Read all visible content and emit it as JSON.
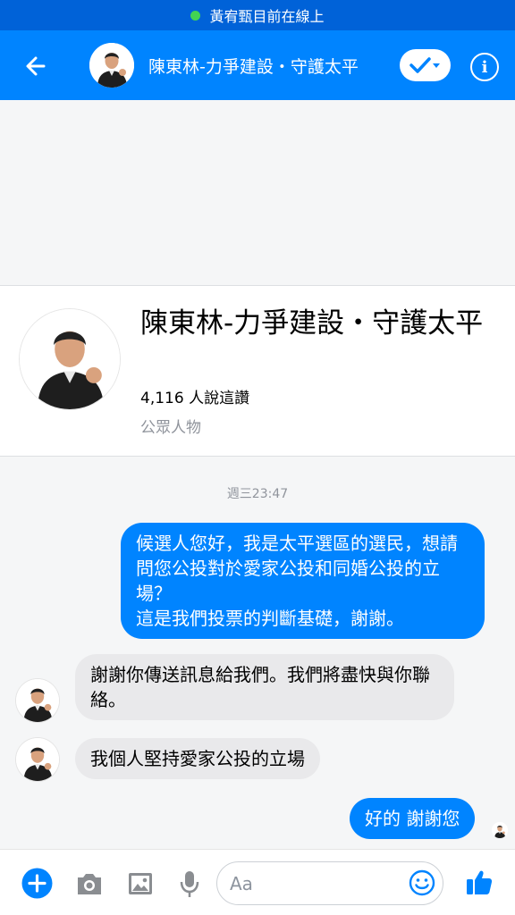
{
  "status": {
    "online_text": "黃宥甄目前在線上"
  },
  "header": {
    "title": "陳東林-力爭建設・守護太平"
  },
  "profile": {
    "name": "陳東林-力爭建設・守護太平",
    "likes": "4,116 人說這讚",
    "category": "公眾人物"
  },
  "thread": {
    "timestamp": "週三23:47",
    "messages": [
      {
        "from": "me",
        "text": "候選人您好，我是太平選區的選民，想請問您公投對於愛家公投和同婚公投的立場？\n這是我們投票的判斷基礎，謝謝。"
      },
      {
        "from": "page",
        "text": "謝謝你傳送訊息給我們。我們將盡快與你聯絡。"
      },
      {
        "from": "page",
        "text": "我個人堅持愛家公投的立場"
      },
      {
        "from": "me",
        "text": "好的 謝謝您"
      }
    ]
  },
  "composer": {
    "placeholder": "Aa"
  },
  "colors": {
    "brand_blue": "#0084ff",
    "status_blue": "#0062d8",
    "online_green": "#42d453"
  },
  "icons": [
    "arrow-left-icon",
    "checkmark-icon",
    "info-icon",
    "plus-icon",
    "camera-icon",
    "gallery-icon",
    "microphone-icon",
    "emoji-icon",
    "thumbs-up-icon"
  ]
}
